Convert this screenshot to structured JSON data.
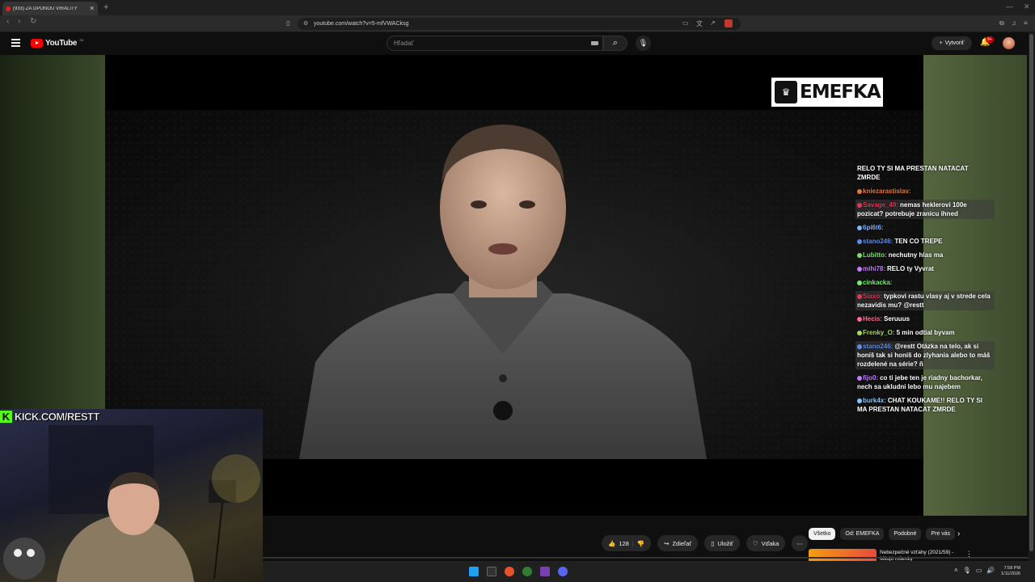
{
  "browser": {
    "tab_title": "(933) ZA OPONOU VIRALITY",
    "url": "youtube.com/watch?v=5-mfVWACksg"
  },
  "youtube": {
    "logo_text": "YouTube",
    "country": "SK",
    "search_placeholder": "Hľadať",
    "create_label": "Vytvoriť",
    "notification_count": "9+"
  },
  "video": {
    "watermark": "EMEFKA"
  },
  "chat": [
    {
      "user": "",
      "user_color": "#ffffff",
      "text": "RELO TY SI MA PRESTAN NATACAT ZMRDE",
      "highlight": false
    },
    {
      "user": "kniezarastislav:",
      "user_color": "#e07a3a",
      "text": "",
      "highlight": false
    },
    {
      "user": "Savage_49:",
      "user_color": "#e0375a",
      "text": "nemas heklerovi 100e pozicat? potrebuje zranicu ihned",
      "highlight": true
    },
    {
      "user": "6pi6t6:",
      "user_color": "#7fb2ff",
      "text": "",
      "highlight": false
    },
    {
      "user": "stano246:",
      "user_color": "#5b8fe8",
      "text": "TEN CO TREPE",
      "highlight": false
    },
    {
      "user": "Lubitto:",
      "user_color": "#7ee06a",
      "text": "nechutny hlas ma",
      "highlight": false
    },
    {
      "user": "mihi78:",
      "user_color": "#c37bff",
      "text": "RELO ty Vyvrat",
      "highlight": false
    },
    {
      "user": "cinkacka:",
      "user_color": "#6ef26e",
      "text": "",
      "highlight": false
    },
    {
      "user": "Siaxo:",
      "user_color": "#e0375a",
      "text": "typkovi rastu vlasy aj v strede cela nezavidis mu? @restt",
      "highlight": true
    },
    {
      "user": "Hecis:",
      "user_color": "#ff6f91",
      "text": "Seruuus",
      "highlight": false
    },
    {
      "user": "Frenky_O:",
      "user_color": "#a9d65c",
      "text": "5 min odtial byvam",
      "highlight": false
    },
    {
      "user": "stano246:",
      "user_color": "#5b8fe8",
      "text": "@restt Otázka na telo, ak si honíš tak si honíš do zlyhania alebo to máš rozdelené na série? ñ",
      "highlight": true
    },
    {
      "user": "fijo0:",
      "user_color": "#c37bff",
      "text": "co ti jebe ten je riadny bachorkar, nech sa ukludni lebo mu najebem",
      "highlight": false
    },
    {
      "user": "burk4x:",
      "user_color": "#7ec8ff",
      "text": "CHAT KOUKAME!! RELO TY SI MA PRESTAN NATACAT ZMRDE",
      "highlight": false
    }
  ],
  "stream": {
    "kick_link": "KICK.COM/RESTT"
  },
  "actions": {
    "like_count": "128",
    "share_label": "Zdieľať",
    "save_label": "Uložiť",
    "thanks_label": "Vďaka"
  },
  "chips": [
    "Všetko",
    "Od: EMEFKA",
    "Podobné",
    "Pre vás"
  ],
  "recommendation": {
    "title": "Nebezpečné vzťahy (2021/59) - Milujú milenky"
  },
  "system": {
    "time": "7:58 PM",
    "date": "1/11/2026"
  },
  "colors": {
    "accent_red": "#ff0000",
    "kick_green": "#53fc18"
  }
}
